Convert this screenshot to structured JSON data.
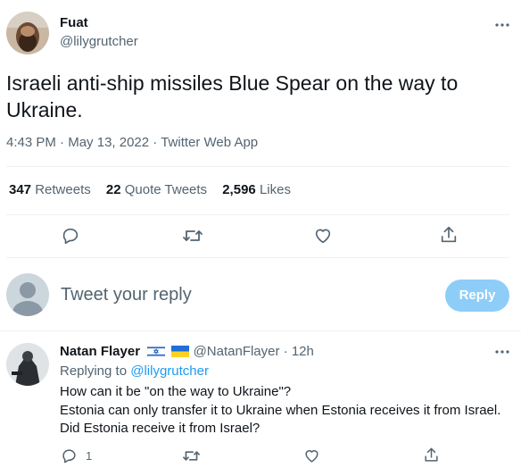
{
  "colors": {
    "accent": "#1d9bf0",
    "muted": "#536471",
    "text": "#0f1419",
    "divider": "#eff3f4",
    "reply_disabled": "#8ecdf8"
  },
  "tweet": {
    "author_name": "Fuat",
    "author_handle": "@lilygrutcher",
    "more_icon": "more-dots-icon",
    "text_line1": "Israeli anti-ship missiles Blue Spear on the way to",
    "text_line2": "Ukraine.",
    "time": "4:43 PM",
    "sep1": "·",
    "date": "May 13, 2022",
    "sep2": "·",
    "source": "Twitter Web App",
    "stats": {
      "retweets_count": "347",
      "retweets_label": "Retweets",
      "quotes_count": "22",
      "quotes_label": "Quote Tweets",
      "likes_count": "2,596",
      "likes_label": "Likes"
    },
    "actions": [
      "reply-icon",
      "retweet-icon",
      "like-icon",
      "share-icon"
    ]
  },
  "composer": {
    "placeholder": "Tweet your reply",
    "button_label": "Reply"
  },
  "reply": {
    "author_name": "Natan Flayer",
    "flags": [
      "israel-flag-icon",
      "ukraine-flag-icon"
    ],
    "author_handle": "@NatanFlayer",
    "sep": "·",
    "time": "12h",
    "replying_to_label": "Replying to",
    "replying_to_handle": "@lilygrutcher",
    "text_line1": "How can it be \"on the way to Ukraine\"?",
    "text_line2": "Estonia can only transfer it to Ukraine when Estonia receives it from Israel.",
    "text_line3": "Did Estonia receive it from Israel?",
    "reply_count": "1"
  }
}
